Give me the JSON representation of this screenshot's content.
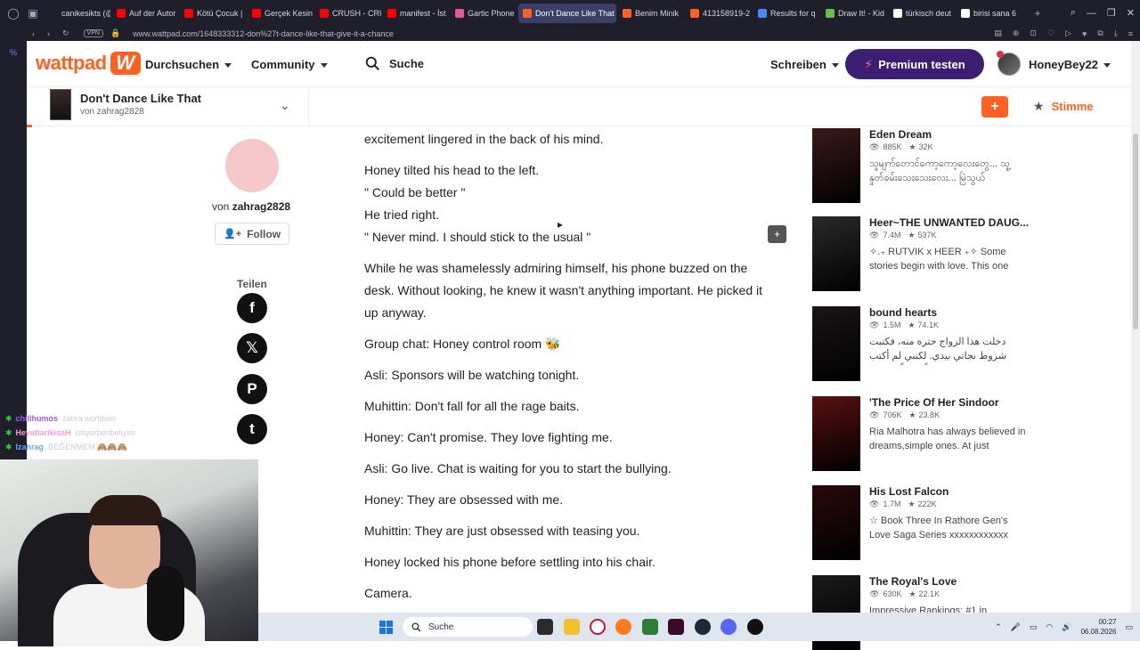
{
  "browser": {
    "tabs": [
      {
        "label": "canikesikts (@",
        "color": "#1f1f2b"
      },
      {
        "label": "Auf der Autor",
        "color": "#ff0000"
      },
      {
        "label": "Kötü Çocuk |",
        "color": "#ff0000"
      },
      {
        "label": "Gerçek Kesin",
        "color": "#ff0000"
      },
      {
        "label": "CRUSH - CRU",
        "color": "#ff0000"
      },
      {
        "label": "manifest - İst",
        "color": "#ff0000"
      },
      {
        "label": "Gartic Phone",
        "color": "#e05a9b"
      },
      {
        "label": "Don't Dance Like That",
        "color": "#ff6122"
      },
      {
        "label": "Benim Minik",
        "color": "#ff6122"
      },
      {
        "label": "413158919-2",
        "color": "#ff6122"
      },
      {
        "label": "Results for q",
        "color": "#4a8af4"
      },
      {
        "label": "Draw It! - Kid",
        "color": "#6cbf4a"
      },
      {
        "label": "türkisch deut",
        "color": "#ffffff"
      },
      {
        "label": "birisi sana 6",
        "color": "#ffffff"
      }
    ],
    "active_tab_index": 7,
    "url": "www.wattpad.com/1648333312-don%27t-dance-like-that-give-it-a-chance",
    "vpn_label": "VPN"
  },
  "header": {
    "logo_text": "wattpad",
    "logo_mark": "W",
    "nav_browse": "Durchsuchen",
    "nav_community": "Community",
    "search_label": "Suche",
    "write": "Schreiben",
    "premium": "Premium testen",
    "username": "HoneyBey22"
  },
  "story": {
    "title": "Don't Dance Like That",
    "author_line": "von zahrag2828",
    "vote": "Stimme",
    "plus": "+"
  },
  "author": {
    "by": "von",
    "name": "zahrag2828",
    "follow": "Follow",
    "share_label": "Teilen"
  },
  "paragraphs": [
    "excitement lingered in the back of his mind.",
    "Honey tilted his head to the left.",
    "\" Could be better \"",
    "He tried right.",
    "\" Never mind. I should stick to the usual \"",
    "While he was shamelessly admiring himself, his phone buzzed on the desk. Without looking, he knew it wasn't anything important. He picked it up anyway.",
    "Group chat: Honey control room 🐝",
    "Asli: Sponsors will be watching tonight.",
    "Muhittin: Don't fall for all the rage baits.",
    "Honey: Can't promise. They love fighting me.",
    "Asli: Go live. Chat is waiting for you to start the bullying.",
    "Honey: They are obsessed with me.",
    "Muhittin: They are just obsessed with teasing you.",
    "Honey locked his phone before settling into his chair.",
    "Camera."
  ],
  "recommendations": [
    {
      "title": "Eden Dream",
      "reads": "885K",
      "votes": "32K",
      "desc": "သူမျက်တောင်ကော့ကော့လေးတွေ... သူ့နှုတ်ခမ်းသေးသေးလေး... မြဲသွယ်",
      "cover": "#3a1a1a"
    },
    {
      "title": "Heer~THE UNWANTED DAUG...",
      "reads": "7.4M",
      "votes": "537K",
      "desc": "✧.₊ RUTVIK x HEER ₊✧ Some stories begin with love. This one",
      "cover": "#2a2a2a"
    },
    {
      "title": "bound hearts",
      "reads": "1.5M",
      "votes": "74.1K",
      "desc": "دخلت هذا الزواج حتره منه، فكتبت شروط نجاتي بيدي. لكنني لم أكتب شرطاً واحداً يحميني",
      "cover": "#1a1418"
    },
    {
      "title": "'The Price Of Her Sindoor",
      "reads": "706K",
      "votes": "23.8K",
      "desc": "Ria Malhotra has always believed in dreams,simple ones. At just",
      "cover": "#5a1010"
    },
    {
      "title": "His Lost Falcon",
      "reads": "1.7M",
      "votes": "222K",
      "desc": "☆ Book Three In Rathore Gen's Love Saga Series xxxxxxxxxxxx",
      "cover": "#2a0a0a"
    },
    {
      "title": "The Royal's Love",
      "reads": "630K",
      "votes": "22.1K",
      "desc": "Impressive Rankings: #1 in",
      "cover": "#1a1a1a"
    }
  ],
  "stream_chat": [
    {
      "user": "chillhumos",
      "msg": "zahra worldwin",
      "color": "#9b59ff"
    },
    {
      "user": "HeyatlarikisaH",
      "msg": "İstiyorbenbeliyim",
      "color": "#ff9bd0"
    },
    {
      "user": "lzahrag",
      "msg": "BEĞENMEM 🙈🙈🙈",
      "color": "#6aa9ff"
    }
  ],
  "taskbar": {
    "search": "Suche",
    "time": "00:27",
    "date": "06.08.2026"
  },
  "colors": {
    "brand": "#ff6122",
    "premium": "#3c1f73"
  }
}
